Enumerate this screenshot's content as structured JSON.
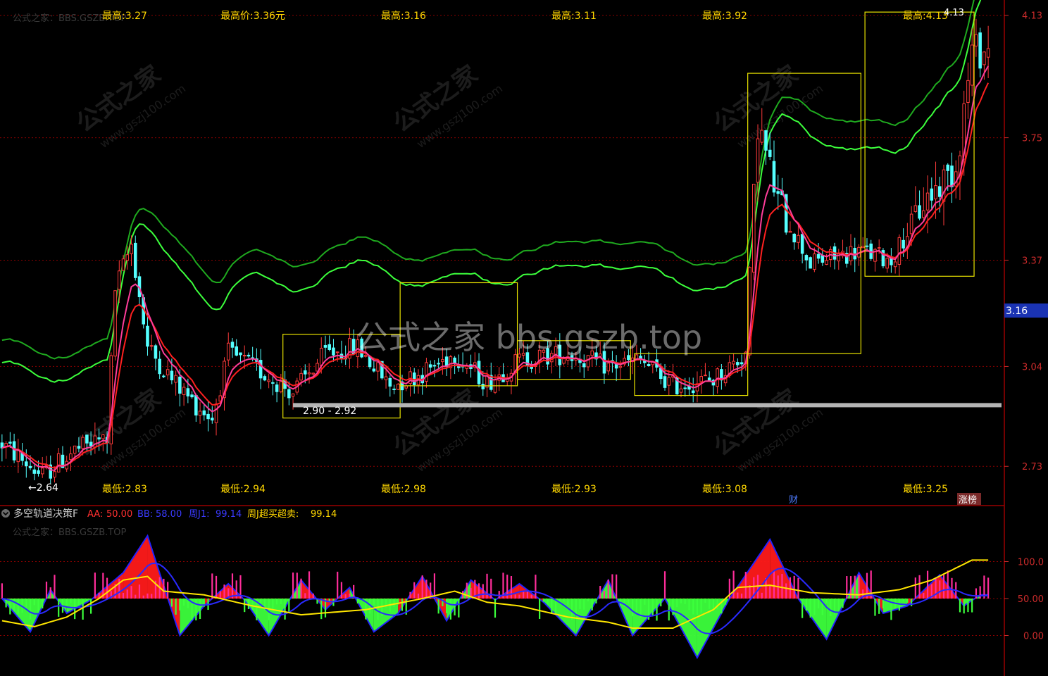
{
  "colors": {
    "background": "#000000",
    "candle_up": "#ff3b3b",
    "candle_down": "#54ffff",
    "ma_red": "#ff2020",
    "ma_pink": "#ff3d9a",
    "band_light": "#3cff3c",
    "band_dark": "#1faa1f",
    "box": "#e8e200",
    "support": "#b4b4b4",
    "grid": "#8b0000",
    "axis_text": "#cc2b2b",
    "label_yellow": "#ffd700"
  },
  "main_panel": {
    "watermark_header": "公式之家：BBS.GSZB.TOP",
    "center_watermark": "公式之家 bbs.gszb.top",
    "tile_watermark_cn": "公式之家",
    "tile_watermark_url": "www.gszj100.com",
    "top_labels": [
      "最高:3.27",
      "最高价:3.36元",
      "最高:3.16",
      "最高:3.11",
      "最高:3.92",
      "最高:4.13"
    ],
    "bottom_labels": [
      "最低:2.83",
      "最低:2.94",
      "最低:2.98",
      "最低:2.93",
      "最低:3.08",
      "最低:3.25"
    ],
    "low_marker": "←2.64",
    "high_marker": "4.13",
    "box_label": "2.90 - 2.92",
    "badge_cai": "财",
    "badge_zhangbang": "涨榜",
    "current_price": "3.16"
  },
  "indicator_panel": {
    "name": "多空轨道决策F",
    "header_watermark": "公式之家：BBS.GSZB.TOP",
    "params": [
      {
        "label": "AA:",
        "value": "50.00",
        "color": "#ff3030"
      },
      {
        "label": "BB:",
        "value": "58.00",
        "color": "#3a3aff"
      },
      {
        "label": "周J1:",
        "value": "99.14",
        "color": "#3a3aff"
      },
      {
        "label": "周J超买超卖:",
        "value": "99.14",
        "color": "#ffd700"
      }
    ]
  },
  "chart_data": [
    {
      "type": "candlestick",
      "y_ticks": [
        "4.13",
        "3.75",
        "3.37",
        "3.04",
        "2.73"
      ],
      "ylim": [
        2.63,
        4.16
      ],
      "grid": true,
      "num_bars": 245,
      "annotations": {
        "support_line": 2.92,
        "boxes": [
          {
            "from_bar": 70,
            "to_bar": 98,
            "low": 2.88,
            "high": 3.14
          },
          {
            "from_bar": 99,
            "to_bar": 127,
            "low": 2.98,
            "high": 3.3
          },
          {
            "from_bar": 128,
            "to_bar": 155,
            "low": 3.0,
            "high": 3.12
          },
          {
            "from_bar": 157,
            "to_bar": 184,
            "low": 2.95,
            "high": 3.08
          },
          {
            "from_bar": 185,
            "to_bar": 212,
            "low": 3.08,
            "high": 3.95
          },
          {
            "from_bar": 214,
            "to_bar": 240,
            "low": 3.32,
            "high": 4.14
          }
        ],
        "regimes": [
          [
            0,
            2.8
          ],
          [
            10,
            2.7
          ],
          [
            18,
            2.78
          ],
          [
            26,
            2.82
          ],
          [
            28,
            3.28
          ],
          [
            32,
            3.42
          ],
          [
            36,
            3.1
          ],
          [
            42,
            3.0
          ],
          [
            48,
            2.92
          ],
          [
            52,
            2.88
          ],
          [
            56,
            3.08
          ],
          [
            62,
            3.04
          ],
          [
            72,
            2.96
          ],
          [
            80,
            3.08
          ],
          [
            88,
            3.1
          ],
          [
            96,
            2.98
          ],
          [
            104,
            3.02
          ],
          [
            112,
            3.08
          ],
          [
            120,
            2.99
          ],
          [
            128,
            3.06
          ],
          [
            140,
            3.08
          ],
          [
            150,
            3.04
          ],
          [
            158,
            3.06
          ],
          [
            166,
            2.98
          ],
          [
            176,
            3.0
          ],
          [
            184,
            3.08
          ],
          [
            187,
            3.8
          ],
          [
            192,
            3.55
          ],
          [
            200,
            3.36
          ],
          [
            206,
            3.38
          ],
          [
            212,
            3.4
          ],
          [
            220,
            3.37
          ],
          [
            228,
            3.55
          ],
          [
            236,
            3.66
          ],
          [
            240,
            4.02
          ]
        ]
      }
    },
    {
      "type": "oscillator",
      "y_ticks": [
        "100.0",
        "50.00",
        "0.00"
      ],
      "ylim": [
        -50,
        150
      ],
      "grid": true,
      "series": [
        {
          "name": "AA",
          "value": 50.0
        },
        {
          "name": "BB",
          "value": 58.0
        },
        {
          "name": "周J1",
          "value": 99.14
        },
        {
          "name": "周J超买超卖",
          "value": 99.14
        }
      ],
      "peaks": [
        [
          0,
          50
        ],
        [
          7,
          5
        ],
        [
          12,
          62
        ],
        [
          16,
          30
        ],
        [
          22,
          48
        ],
        [
          30,
          85
        ],
        [
          36,
          135
        ],
        [
          44,
          0
        ],
        [
          50,
          40
        ],
        [
          56,
          70
        ],
        [
          60,
          48
        ],
        [
          66,
          0
        ],
        [
          74,
          75
        ],
        [
          80,
          35
        ],
        [
          86,
          65
        ],
        [
          92,
          5
        ],
        [
          98,
          30
        ],
        [
          104,
          80
        ],
        [
          110,
          20
        ],
        [
          116,
          75
        ],
        [
          122,
          48
        ],
        [
          128,
          70
        ],
        [
          134,
          45
        ],
        [
          142,
          0
        ],
        [
          150,
          75
        ],
        [
          156,
          0
        ],
        [
          164,
          50
        ],
        [
          172,
          -30
        ],
        [
          180,
          50
        ],
        [
          190,
          130
        ],
        [
          197,
          50
        ],
        [
          204,
          -5
        ],
        [
          212,
          85
        ],
        [
          218,
          30
        ],
        [
          224,
          40
        ],
        [
          232,
          82
        ],
        [
          238,
          40
        ],
        [
          242,
          55
        ]
      ],
      "weekly_j": [
        [
          0,
          20
        ],
        [
          8,
          12
        ],
        [
          16,
          25
        ],
        [
          24,
          50
        ],
        [
          30,
          75
        ],
        [
          36,
          80
        ],
        [
          40,
          60
        ],
        [
          50,
          55
        ],
        [
          62,
          40
        ],
        [
          74,
          28
        ],
        [
          90,
          35
        ],
        [
          104,
          50
        ],
        [
          112,
          60
        ],
        [
          120,
          45
        ],
        [
          128,
          40
        ],
        [
          140,
          25
        ],
        [
          150,
          18
        ],
        [
          156,
          10
        ],
        [
          166,
          10
        ],
        [
          176,
          35
        ],
        [
          182,
          65
        ],
        [
          190,
          68
        ],
        [
          200,
          58
        ],
        [
          212,
          55
        ],
        [
          222,
          62
        ],
        [
          230,
          75
        ],
        [
          240,
          102
        ]
      ]
    }
  ]
}
